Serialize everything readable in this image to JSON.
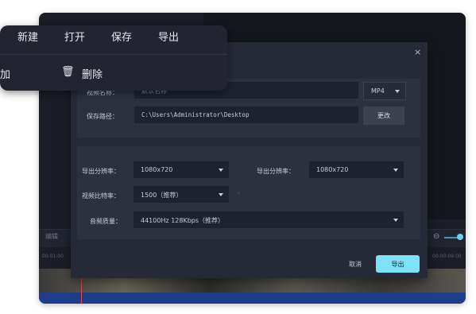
{
  "menu": {
    "top_items": [
      "新建",
      "打开",
      "保存",
      "导出"
    ],
    "add_label": "添加",
    "add_label_visible": "添加",
    "delete_label": "删除"
  },
  "background": {
    "edit_label": "编辑",
    "ruler_left": "00:01:00",
    "ruler_right": "00:00:09:00"
  },
  "dialog": {
    "close_glyph": "×",
    "name_label": "视频名称：",
    "name_value": "默认名称",
    "format_value": "MP4",
    "path_label": "保存路径：",
    "path_value": "C:\\Users\\Administrator\\Desktop",
    "change_button": "更改",
    "res1_label": "导出分辨率：",
    "res1_value": "1080x720",
    "res2_label": "导出分辨率：",
    "res2_value": "1080x720",
    "bitrate_label": "视频比特率：",
    "bitrate_value": "1500（推荐）",
    "audio_label": "音频质量：",
    "audio_value": "44100Hz 128Kbps（推荐）",
    "cancel_button": "取消",
    "export_button": "导出"
  },
  "colors": {
    "accent": "#7fe1f7",
    "dialog_bg": "#252a36",
    "field_bg": "#1e2230"
  }
}
